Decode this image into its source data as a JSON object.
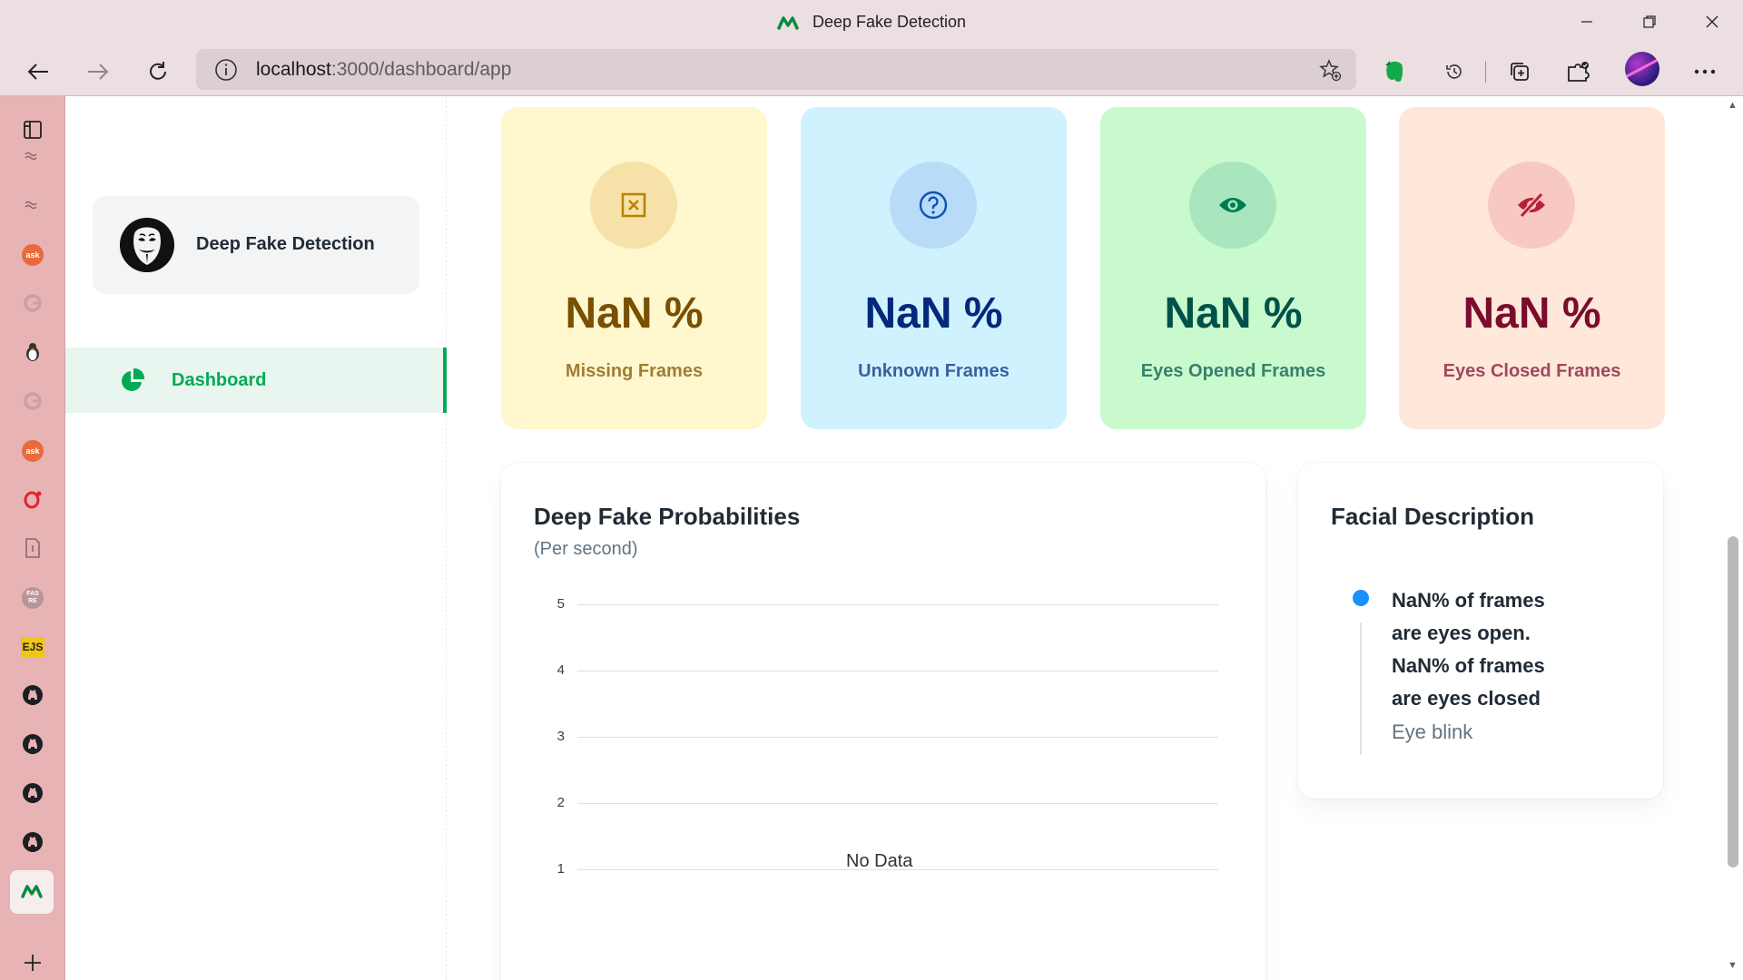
{
  "window": {
    "title": "Deep Fake Detection"
  },
  "browser": {
    "url_host": "localhost",
    "url_path": ":3000/dashboard/app"
  },
  "vertical_tabs": [
    {
      "icon": "generic-link-icon",
      "text": ""
    },
    {
      "icon": "generic-link-icon",
      "text": ""
    },
    {
      "icon": "ask-icon",
      "text": "ask"
    },
    {
      "icon": "google-icon",
      "text": ""
    },
    {
      "icon": "linux-penguin-icon",
      "text": ""
    },
    {
      "icon": "google-icon",
      "text": ""
    },
    {
      "icon": "ask-icon",
      "text": "ask"
    },
    {
      "icon": "opera-icon",
      "text": ""
    },
    {
      "icon": "document-icon",
      "text": ""
    },
    {
      "icon": "fasre-icon",
      "text": ""
    },
    {
      "icon": "ejs-icon",
      "text": "EJS"
    },
    {
      "icon": "github-icon",
      "text": ""
    },
    {
      "icon": "github-icon",
      "text": ""
    },
    {
      "icon": "github-icon",
      "text": ""
    },
    {
      "icon": "github-icon",
      "text": ""
    },
    {
      "icon": "app-logo-icon",
      "text": ""
    }
  ],
  "sidebar": {
    "account_name": "Deep Fake Detection",
    "nav": [
      {
        "label": "Dashboard",
        "icon": "pie-chart-icon",
        "active": true
      }
    ]
  },
  "cards": [
    {
      "value": "NaN %",
      "label": "Missing Frames",
      "icon": "box-x-icon",
      "bg": "#fff7cd",
      "fg": "#7a4f01",
      "circle": "#f6e2a8",
      "iconColor": "#b78103"
    },
    {
      "value": "NaN %",
      "label": "Unknown Frames",
      "icon": "question-circle-icon",
      "bg": "#d0f2ff",
      "fg": "#04297a",
      "circle": "#b8dcf7",
      "iconColor": "#0c53b7"
    },
    {
      "value": "NaN %",
      "label": "Eyes Opened Frames",
      "icon": "eye-icon",
      "bg": "#c8facd",
      "fg": "#005249",
      "circle": "#a9e6bd",
      "iconColor": "#007b55"
    },
    {
      "value": "NaN %",
      "label": "Eyes Closed Frames",
      "icon": "eye-off-icon",
      "bg": "#ffe7d9",
      "fg": "#7a0c2e",
      "circle": "#f8c9c3",
      "iconColor": "#b72136"
    }
  ],
  "probabilities": {
    "title": "Deep Fake Probabilities",
    "subtitle": "(Per second)",
    "empty_text": "No Data"
  },
  "chart_data": {
    "type": "line",
    "title": "Deep Fake Probabilities",
    "subtitle": "(Per second)",
    "x": [],
    "series": [],
    "y_ticks": [
      "5",
      "4",
      "3",
      "2",
      "1"
    ],
    "ylim": [
      1,
      5
    ],
    "grid": true,
    "annotation": "No Data"
  },
  "facial": {
    "title": "Facial Description",
    "text": "NaN% of frames are eyes open. NaN% of frames are eyes closed",
    "sub": "Eye blink"
  },
  "colors": {
    "accent": "#00ab55",
    "timeline_dot": "#1890ff"
  }
}
